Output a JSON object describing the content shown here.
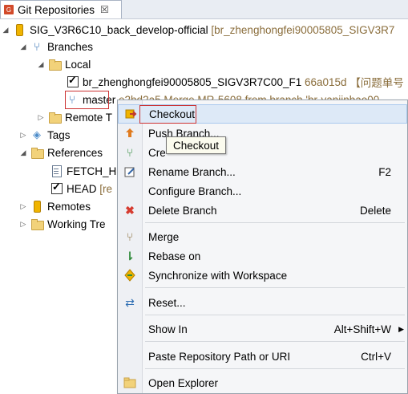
{
  "tab": {
    "title": "Git Repositories",
    "close": "☒"
  },
  "tree": {
    "repo": {
      "name": "SIG_V3R6C10_back_develop-official",
      "branch_info": "[br_zhenghongfei90005805_SIGV3R7"
    },
    "branches": "Branches",
    "local": "Local",
    "local_branch": {
      "name": "br_zhenghongfei90005805_SIGV3R7C00_F1",
      "hash": "66a015d",
      "message": "【问题单号"
    },
    "master": {
      "name": "master",
      "rest": "e2bd2a5 Merge MR-5608 from branch 'br-yanjinbao00"
    },
    "remote_tracking": "Remote T",
    "tags": "Tags",
    "references": "References",
    "fetch_head": "FETCH_HE",
    "head": "HEAD",
    "head_suffix": "[re",
    "remotes": "Remotes",
    "working_tree": "Working Tre"
  },
  "menu": {
    "checkout": "Checkout",
    "push_branch": "Push Branch...",
    "create_branch": "Cre",
    "rename_branch": "Rename Branch...",
    "rename_key": "F2",
    "configure_branch": "Configure Branch...",
    "delete_branch": "Delete Branch",
    "delete_key": "Delete",
    "merge": "Merge",
    "rebase": "Rebase on",
    "synchronize": "Synchronize with Workspace",
    "reset": "Reset...",
    "show_in": "Show In",
    "show_in_key": "Alt+Shift+W",
    "paste_path": "Paste Repository Path or URI",
    "paste_key": "Ctrl+V",
    "open_explorer": "Open Explorer"
  },
  "tooltip": "Checkout",
  "colors": {
    "highlight": "#dde9f7",
    "selection_box": "#cc3333",
    "annotation": "#8a6d3b"
  }
}
